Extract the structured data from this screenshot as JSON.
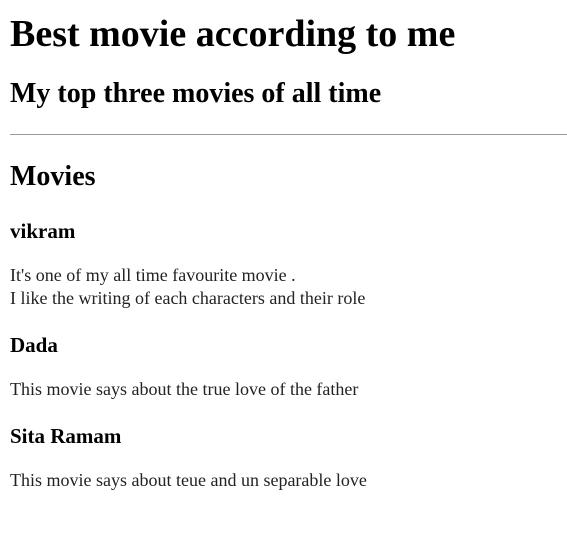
{
  "header": {
    "title": "Best movie according to me",
    "subtitle": "My top three movies of all time"
  },
  "section": {
    "heading": "Movies"
  },
  "movies": [
    {
      "title": "vikram",
      "description_lines": [
        "It's one of my all time favourite movie .",
        "I like the writing of each characters and their role"
      ]
    },
    {
      "title": "Dada",
      "description_lines": [
        "This movie says about the true love of the father"
      ]
    },
    {
      "title": "Sita Ramam",
      "description_lines": [
        "This movie says about teue and un separable love"
      ]
    }
  ]
}
